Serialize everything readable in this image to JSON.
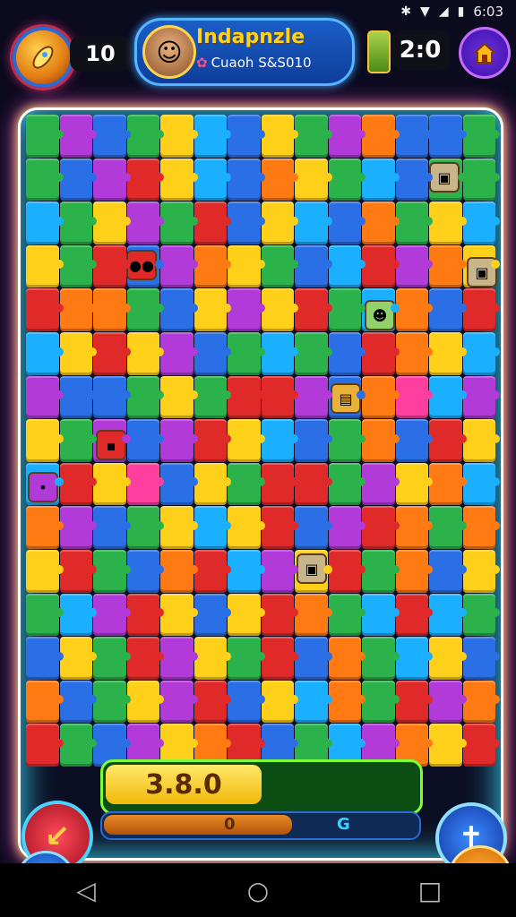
{
  "status_bar": {
    "time": "6:03",
    "icons": [
      "bluetooth-icon",
      "wifi-icon",
      "signal-icon",
      "battery-icon"
    ]
  },
  "hud": {
    "coin_count": "10",
    "profile": {
      "title": "Indapnzle",
      "subtitle": "Cuaoh S&S010"
    },
    "timer": "2:0",
    "icons": {
      "coin": "coin-rocket-icon",
      "timer": "battery-timer-icon",
      "home": "home-icon"
    }
  },
  "board": {
    "rows": 15,
    "cols": 14,
    "palette": [
      "#e02a2a",
      "#2a6fe6",
      "#2bb24a",
      "#ffd01a",
      "#ff7a12",
      "#b23ad8",
      "#1ab0ff",
      "#ff3fa0"
    ],
    "pieces": [
      "2512361325411",
      "21503614326122",
      "6235201361423",
      "3201543216054",
      "0442135302641",
      "6303512621043",
      "5112320051476",
      "3251503612410",
      "6037132002534",
      "4512363015042",
      "3021406530241",
      "2650313042606",
      "1320532014263",
      "4123501364205",
      "0215340126543"
    ]
  },
  "score": {
    "value": "3.8.0",
    "fill_fraction": 0.5
  },
  "progress": {
    "left_label": "0",
    "right_label": "G",
    "fill_fraction": 0.6
  },
  "buttons": {
    "undo": "undo-icon",
    "confirm": "check-icon",
    "hint": "cross-icon",
    "tool": "tool-icon"
  },
  "navbar": {
    "back": "◁",
    "home": "○",
    "recent": "□"
  }
}
